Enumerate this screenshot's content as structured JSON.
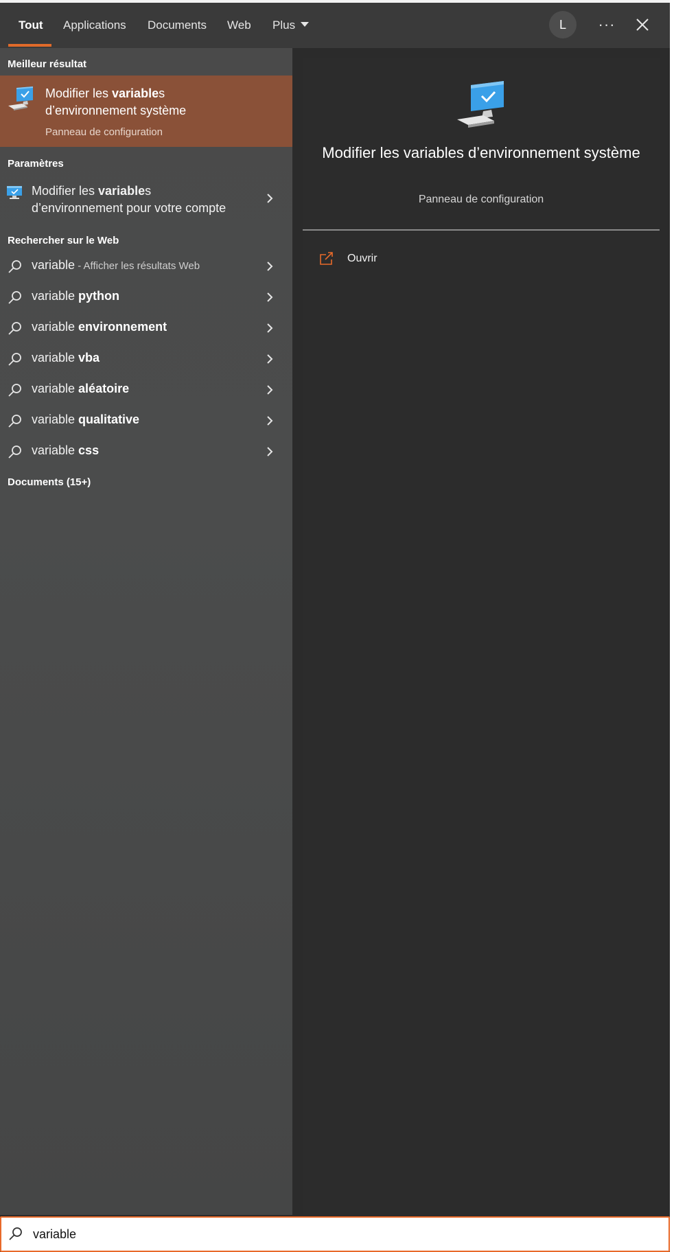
{
  "nav": {
    "tabs": [
      {
        "label": "Tout",
        "active": true
      },
      {
        "label": "Applications"
      },
      {
        "label": "Documents"
      },
      {
        "label": "Web"
      },
      {
        "label": "Plus"
      }
    ],
    "avatar_letter": "L",
    "more_label": "···"
  },
  "left": {
    "best_header": "Meilleur résultat",
    "best": {
      "title_pre": "Modifier les ",
      "title_bold": "variable",
      "title_post": "s",
      "title_line2": "d’environnement système",
      "subtitle": "Panneau de configuration",
      "icon": "computer-check-icon"
    },
    "params_header": "Paramètres",
    "param": {
      "pre": "Modifier les ",
      "bold": "variable",
      "post": "s",
      "line2": "d’environnement pour votre compte"
    },
    "web_header": "Rechercher sur le Web",
    "web_first": {
      "query": "variable",
      "sub": " - Afficher les résultats Web"
    },
    "web_suggestions": [
      {
        "prefix": "variable ",
        "bold": "python"
      },
      {
        "prefix": "variable ",
        "bold": "environnement"
      },
      {
        "prefix": "variable ",
        "bold": "vba"
      },
      {
        "prefix": "variable ",
        "bold": "aléatoire"
      },
      {
        "prefix": "variable ",
        "bold": "qualitative"
      },
      {
        "prefix": "variable ",
        "bold": "css"
      }
    ],
    "docs_header": "Documents (15+)"
  },
  "right": {
    "title": "Modifier les variables d’environnement système",
    "subtitle": "Panneau de configuration",
    "open_label": "Ouvrir"
  },
  "search": {
    "value": "variable"
  },
  "colors": {
    "accent": "#e06a2a",
    "best_bg": "#8a5138"
  }
}
